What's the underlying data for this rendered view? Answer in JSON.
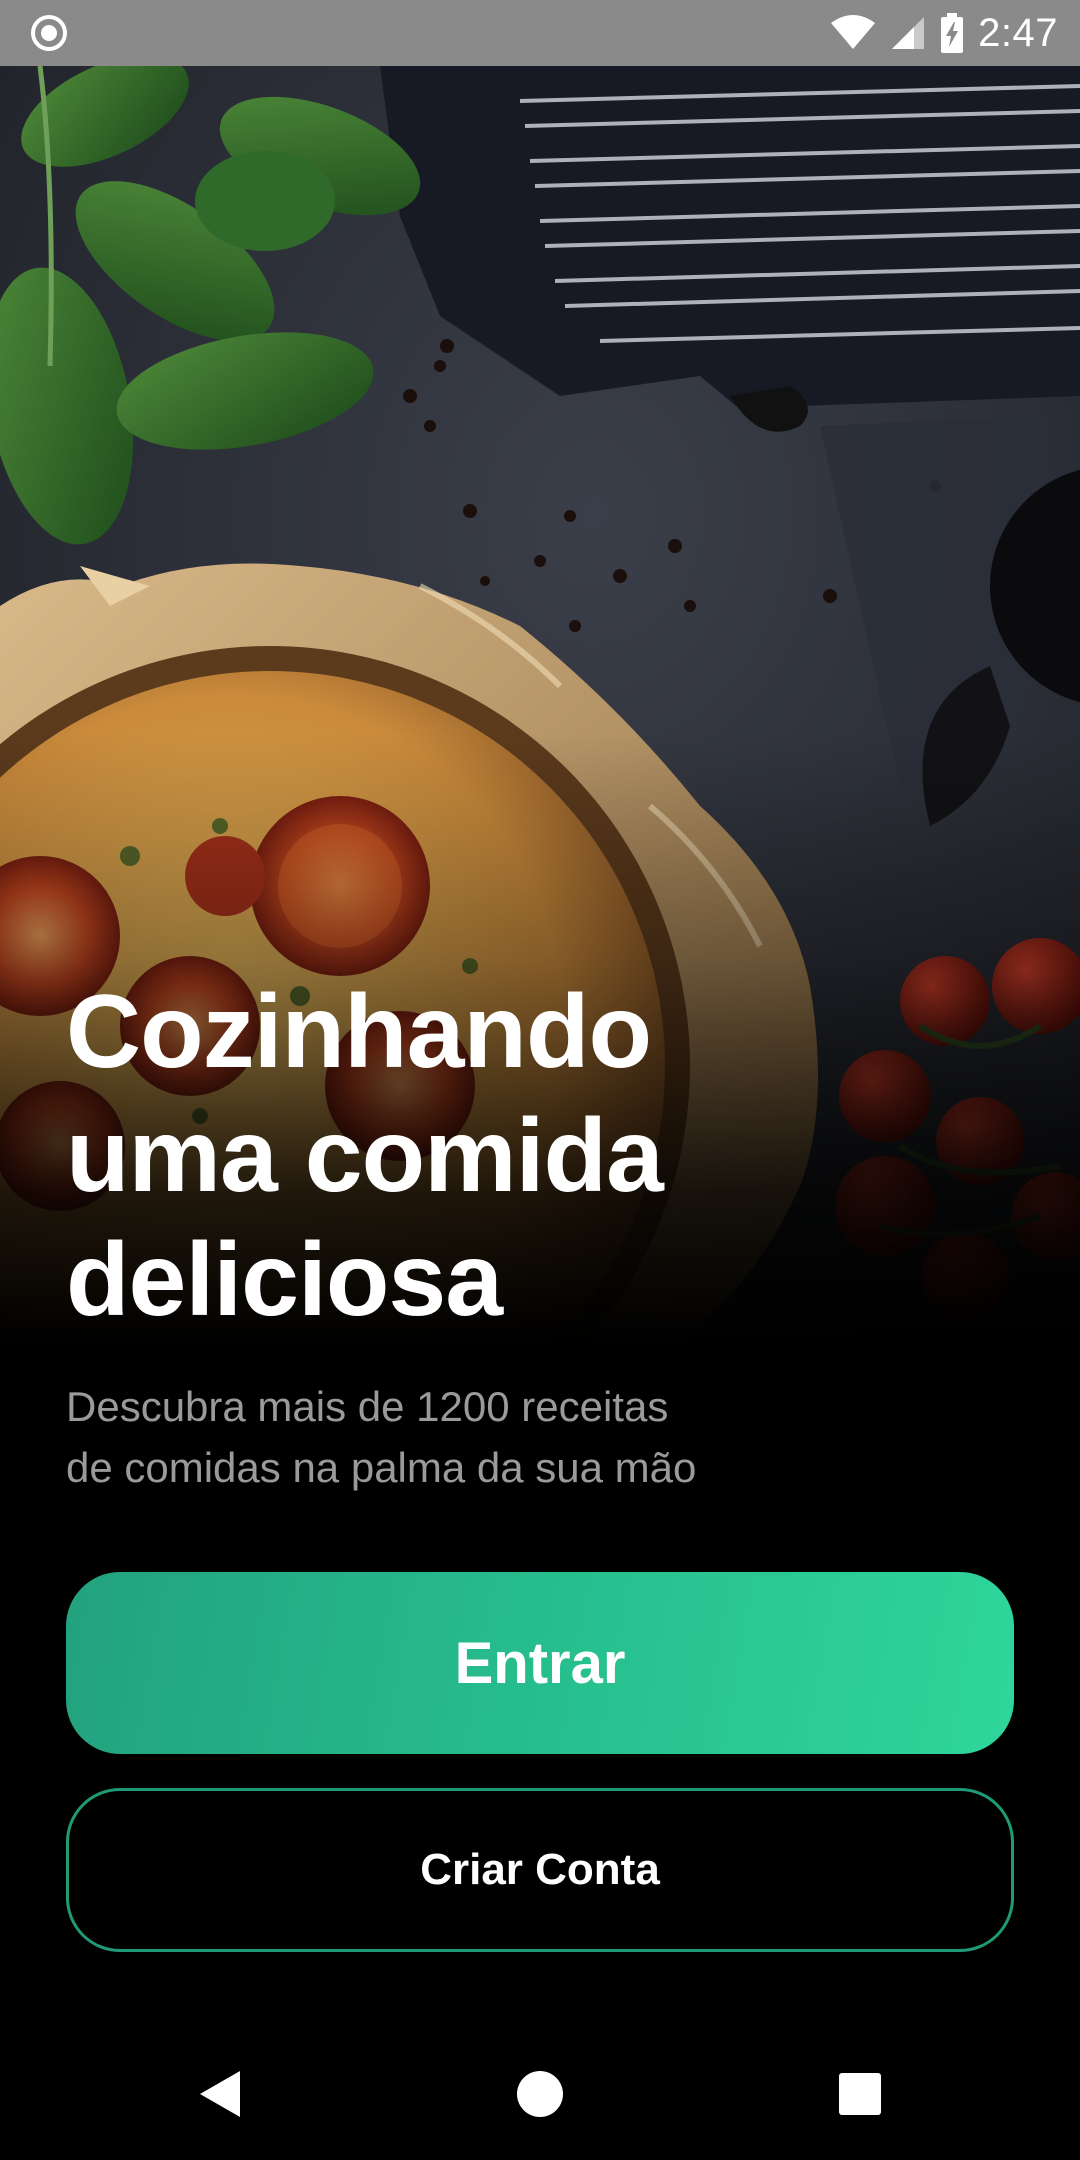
{
  "status_bar": {
    "time": "2:47",
    "icons": [
      "record-icon",
      "wifi-icon",
      "cell-signal-icon",
      "battery-charging-icon"
    ]
  },
  "hero": {
    "image": "food-photo-quiche-spinach-tomatoes"
  },
  "content": {
    "headline_line1": "Cozinhando",
    "headline_line2": "uma comida",
    "headline_line3": "deliciosa",
    "subtitle_line1": "Descubra mais de 1200 receitas",
    "subtitle_line2": "de comidas na palma da sua mão"
  },
  "actions": {
    "login_label": "Entrar",
    "signup_label": "Criar Conta"
  },
  "nav": {
    "icons": [
      "back-icon",
      "home-icon",
      "recents-icon"
    ]
  },
  "colors": {
    "accent": "#27c08f",
    "accent_dark": "#22a27e",
    "background": "#000000",
    "status_bar": "#8a8a8a",
    "subtitle": "#9a9a9a"
  }
}
